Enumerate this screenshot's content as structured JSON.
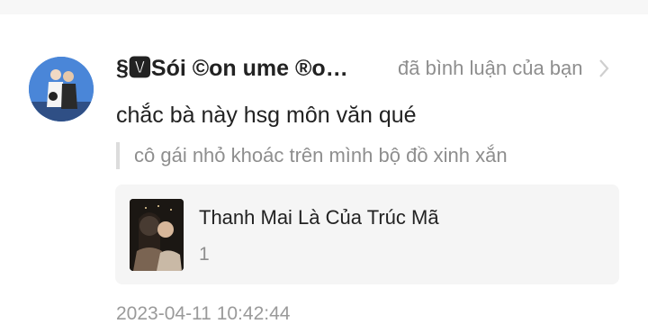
{
  "notification": {
    "username": "§🆅Sói ©on ume ®o…",
    "action_text": "đã bình luận của bạn",
    "comment": "chắc bà này hsg môn văn qué",
    "quoted_comment": "cô gái nhỏ khoác trên mình bộ đồ xinh xắn",
    "video": {
      "title": "Thanh Mai Là Của Trúc Mã",
      "count": "1"
    },
    "timestamp": "2023-04-11 10:42:44"
  },
  "icons": {
    "avatar": "user-avatar",
    "chevron": "chevron-right-icon",
    "thumbnail": "video-thumbnail"
  },
  "colors": {
    "primary_text": "#222222",
    "secondary_text": "#8e8e8e",
    "card_bg": "#f5f5f5",
    "page_bg": "#f7f7f7"
  }
}
